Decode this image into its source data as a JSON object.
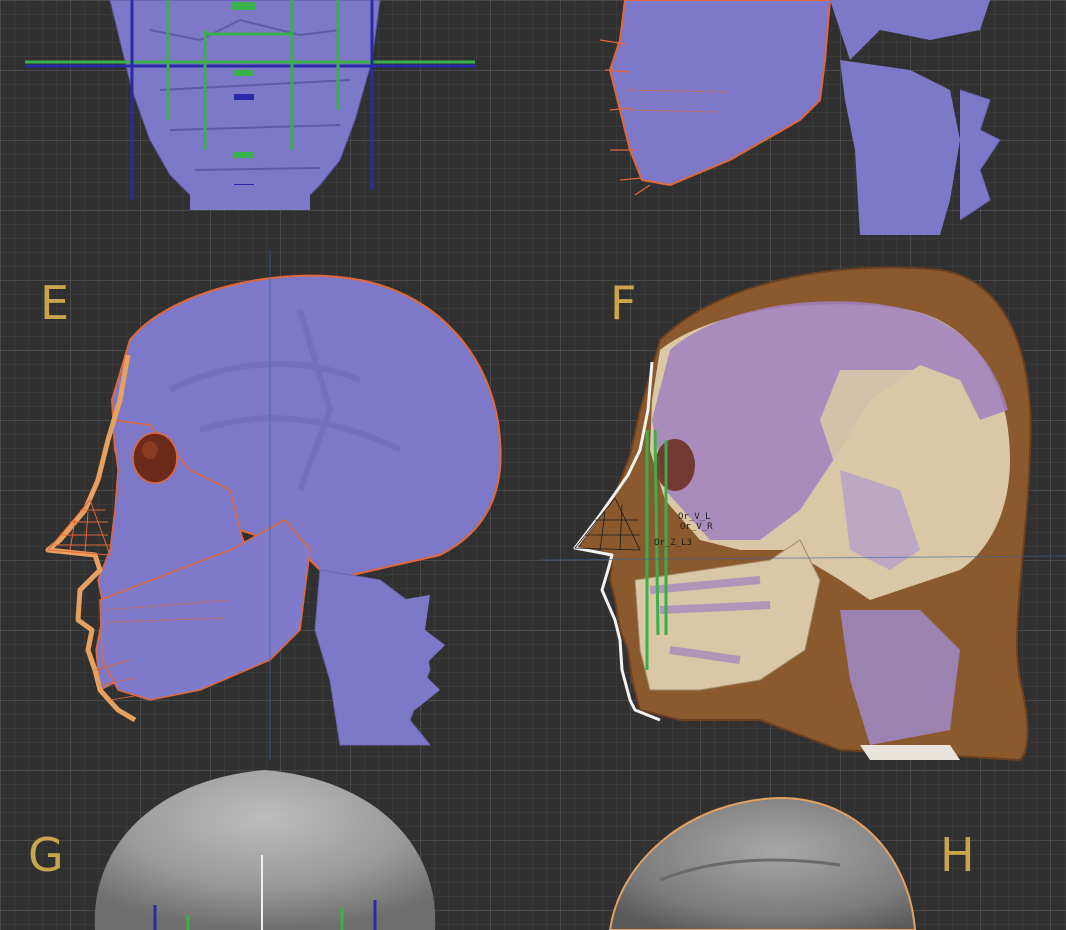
{
  "panels": {
    "e": {
      "label": "E"
    },
    "f": {
      "label": "F",
      "annotations": [
        "Or_V_L",
        "Or_V_R",
        "Or_Z_L3"
      ]
    },
    "g": {
      "label": "G"
    },
    "h": {
      "label": "H"
    }
  },
  "colors": {
    "bone": "#7d78c8",
    "outline": "#e0683a",
    "skin": "#8a5a2e",
    "skull_tan": "#d9c7a6",
    "label": "#c8a54a",
    "grid_bg": "#303030",
    "clay": "#9a9a9a"
  }
}
